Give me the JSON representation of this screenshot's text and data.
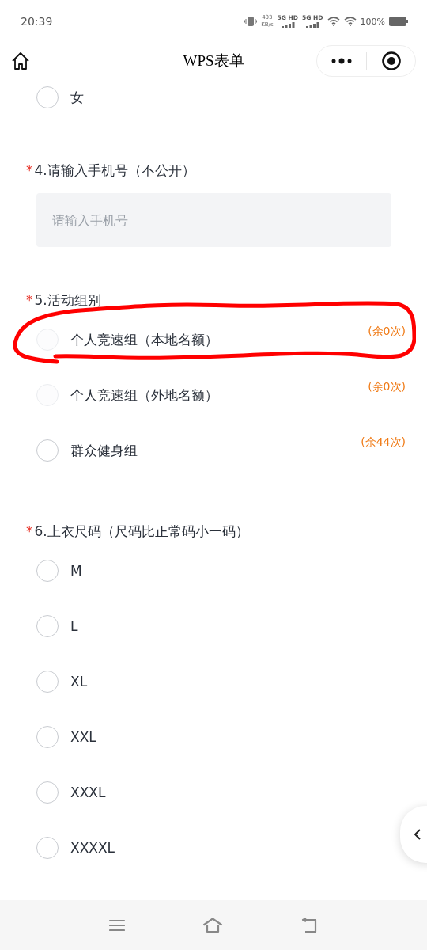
{
  "status_bar": {
    "time": "20:39",
    "speed": "403",
    "speed_unit": "KB/s",
    "networks": [
      "5G HD",
      "5G HD"
    ],
    "battery": "100%"
  },
  "header": {
    "title": "WPS表单"
  },
  "prior_options": [
    {
      "label": "女",
      "selected": false
    }
  ],
  "questions": [
    {
      "kind": "input",
      "required_mark": "*",
      "label": "4.请输入手机号（不公开）",
      "placeholder": "请输入手机号"
    },
    {
      "kind": "choice",
      "required_mark": "*",
      "label": "5.活动组别",
      "options": [
        {
          "label": "个人竞速组（本地名额）",
          "quota": "(余0次)",
          "selected": false,
          "disabled": true
        },
        {
          "label": "个人竞速组（外地名额）",
          "quota": "(余0次)",
          "selected": false,
          "disabled": true
        },
        {
          "label": "群众健身组",
          "quota": "(余44次)",
          "selected": false,
          "disabled": false
        }
      ]
    },
    {
      "kind": "choice",
      "required_mark": "*",
      "label": "6.上衣尺码（尺码比正常码小一码）",
      "options": [
        {
          "label": "M",
          "selected": false,
          "disabled": false
        },
        {
          "label": "L",
          "selected": false,
          "disabled": false
        },
        {
          "label": "XL",
          "selected": false,
          "disabled": false
        },
        {
          "label": "XXL",
          "selected": false,
          "disabled": false
        },
        {
          "label": "XXXL",
          "selected": false,
          "disabled": false
        },
        {
          "label": "XXXXL",
          "selected": false,
          "disabled": false
        }
      ]
    }
  ]
}
